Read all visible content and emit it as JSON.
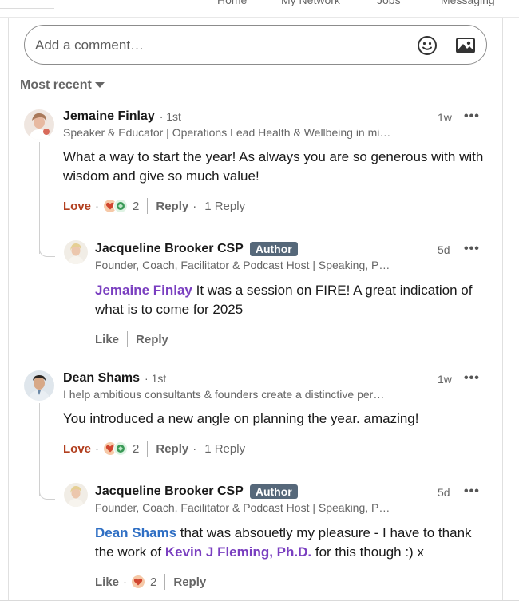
{
  "topnav": {
    "items": [
      "Home",
      "My Network",
      "Jobs",
      "Messaging"
    ]
  },
  "comment_box": {
    "placeholder": "Add a comment…",
    "emoji_icon": "emoji-smile-icon",
    "image_icon": "image-icon"
  },
  "sort": {
    "label": "Most recent"
  },
  "colors": {
    "love": "#b24020",
    "mention": "#7a3fc0",
    "mention_link": "#2f6fc4",
    "badge": "#56687a"
  },
  "comments": [
    {
      "name": "Jemaine Finlay",
      "degree": "· 1st",
      "headline": "Speaker & Educator | Operations Lead Health & Wellbeing in mi…",
      "time": "1w",
      "more": "•••",
      "text": "What a way to start the year! As always you are so generous with with wisdom and give so much value!",
      "reaction_label": "Love",
      "reaction_count": "2",
      "reply_label": "Reply",
      "replies_label": "1 Reply",
      "reply": {
        "name": "Jacqueline Brooker CSP",
        "badge": "Author",
        "headline": "Founder, Coach, Facilitator & Podcast Host | Speaking, P…",
        "time": "5d",
        "more": "•••",
        "mention": "Jemaine Finlay",
        "text": " It was a session on FIRE! A great indication of what is to come for 2025",
        "like_label": "Like",
        "reply_label": "Reply"
      }
    },
    {
      "name": "Dean Shams",
      "degree": "· 1st",
      "headline": "I help ambitious consultants & founders create a distinctive per…",
      "time": "1w",
      "more": "•••",
      "text": "You introduced a new angle on planning the year. amazing!",
      "reaction_label": "Love",
      "reaction_count": "2",
      "reply_label": "Reply",
      "replies_label": "1 Reply",
      "reply": {
        "name": "Jacqueline Brooker CSP",
        "badge": "Author",
        "headline": "Founder, Coach, Facilitator & Podcast Host | Speaking, P…",
        "time": "5d",
        "more": "•••",
        "mention": "Dean Shams",
        "text_part1": " that was absouetly my pleasure - I have to thank the work of ",
        "mention2": "Kevin J Fleming, Ph.D.",
        "text_part2": " for this though :) x",
        "like_label": "Like",
        "like_count": "2",
        "reply_label": "Reply"
      }
    }
  ]
}
